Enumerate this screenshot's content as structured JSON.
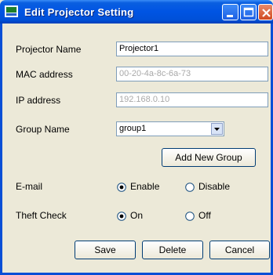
{
  "window": {
    "title": "Edit Projector Setting"
  },
  "form": {
    "projector_name": {
      "label": "Projector Name",
      "value": "Projector1"
    },
    "mac_address": {
      "label": "MAC address",
      "value": "00-20-4a-8c-6a-73"
    },
    "ip_address": {
      "label": "IP address",
      "value": "192.168.0.10"
    },
    "group_name": {
      "label": "Group Name",
      "selected": "group1"
    },
    "add_group_label": "Add New Group",
    "email": {
      "label": "E-mail",
      "options": [
        "Enable",
        "Disable"
      ],
      "selected": "Enable"
    },
    "theft_check": {
      "label": "Theft Check",
      "options": [
        "On",
        "Off"
      ],
      "selected": "On"
    }
  },
  "buttons": {
    "save": "Save",
    "delete": "Delete",
    "cancel": "Cancel"
  },
  "colors": {
    "titlebar": "#0054E3",
    "dialog_bg": "#ECE9D8",
    "close": "#D14A20"
  }
}
